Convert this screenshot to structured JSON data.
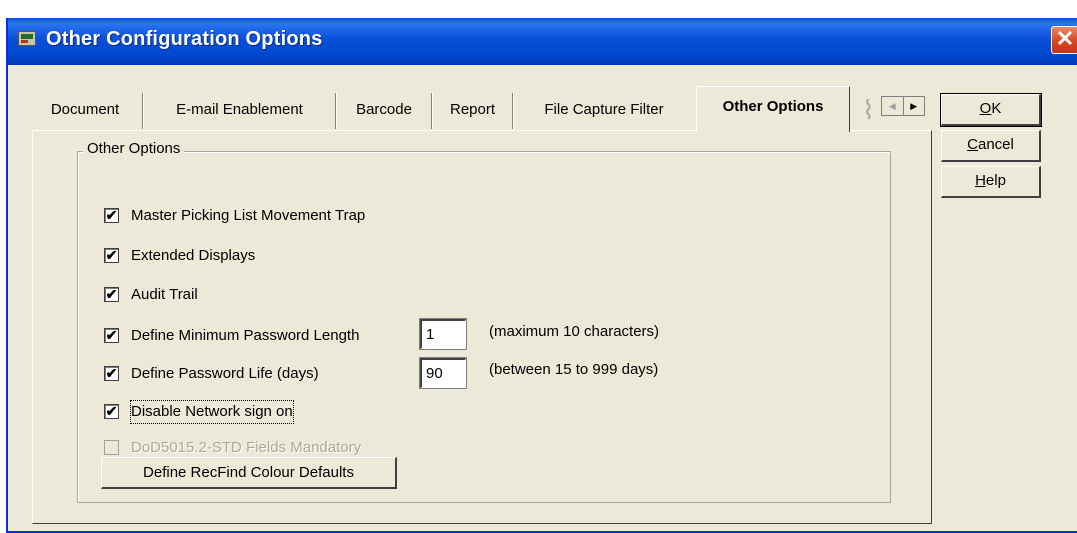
{
  "window": {
    "title": "Other Configuration Options",
    "close_glyph": "✕"
  },
  "tabs": [
    {
      "label": "Document"
    },
    {
      "label": "E-mail Enablement"
    },
    {
      "label": "Barcode"
    },
    {
      "label": "Report"
    },
    {
      "label": "File Capture Filter"
    },
    {
      "label": "Other Options",
      "active": true
    }
  ],
  "tab_scroll": {
    "left_glyph": "◀",
    "right_glyph": "▶"
  },
  "group": {
    "label": "Other Options"
  },
  "options": [
    {
      "label": "Master Picking List Movement Trap",
      "checked": true,
      "enabled": true
    },
    {
      "label": "Extended Displays",
      "checked": true,
      "enabled": true
    },
    {
      "label": "Audit Trail",
      "checked": true,
      "enabled": true
    },
    {
      "label": "Define Minimum Password Length",
      "checked": true,
      "enabled": true,
      "value": "1",
      "hint": "(maximum 10 characters)"
    },
    {
      "label": "Define Password Life (days)",
      "checked": true,
      "enabled": true,
      "value": "90",
      "hint": "(between 15 to 999 days)"
    },
    {
      "label": "Disable Network sign on",
      "checked": true,
      "enabled": true,
      "focused": true
    },
    {
      "label": "DoD5015.2-STD Fields Mandatory",
      "checked": false,
      "enabled": false
    }
  ],
  "check_glyph": "✔",
  "colour_button": {
    "label": "Define RecFind Colour Defaults"
  },
  "buttons": {
    "ok": {
      "mnemonic": "O",
      "rest": "K"
    },
    "cancel": {
      "mnemonic": "C",
      "rest": "ancel"
    },
    "help": {
      "mnemonic": "H",
      "rest": "elp"
    }
  },
  "colors": {
    "titlebar": "#0a4fd8",
    "face": "#ece9d8",
    "close": "#d8461f"
  }
}
